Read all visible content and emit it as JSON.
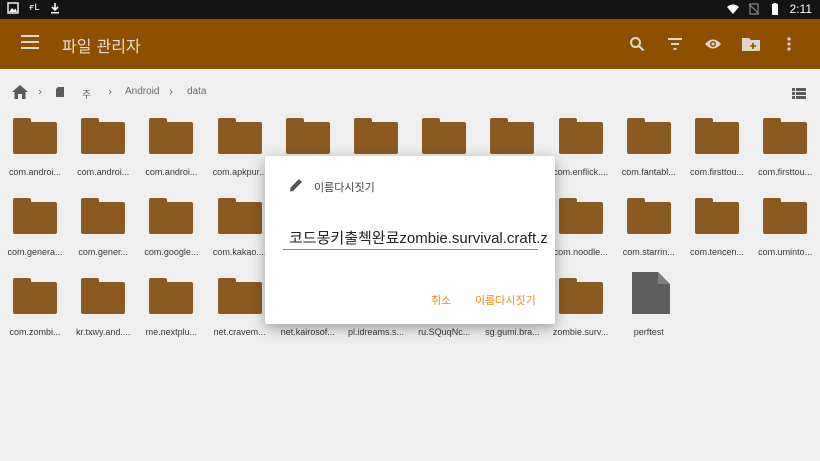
{
  "status_bar": {
    "left_icons": [
      "image-icon",
      "fl-icon",
      "download-icon"
    ],
    "fl_text": "ғL",
    "time": "2:11"
  },
  "app_bar": {
    "title": "파일 관리자",
    "color": "#ff9800",
    "actions": [
      "search-icon",
      "filter-icon",
      "eye-icon",
      "new-folder-icon",
      "more-vert-icon"
    ]
  },
  "breadcrumb": {
    "items": [
      "주",
      "Android",
      "data"
    ]
  },
  "files": [
    {
      "label": "com.androi...",
      "type": "folder"
    },
    {
      "label": "com.androi...",
      "type": "folder"
    },
    {
      "label": "com.androi...",
      "type": "folder"
    },
    {
      "label": "com.apkpur...",
      "type": "folder"
    },
    {
      "label": "",
      "type": "folder"
    },
    {
      "label": "",
      "type": "folder"
    },
    {
      "label": "",
      "type": "folder"
    },
    {
      "label": "",
      "type": "folder"
    },
    {
      "label": "com.enflick....",
      "type": "folder"
    },
    {
      "label": "com.fantabl...",
      "type": "folder"
    },
    {
      "label": "com.firsttou...",
      "type": "folder"
    },
    {
      "label": "com.firsttou...",
      "type": "folder"
    },
    {
      "label": "com.genera...",
      "type": "folder"
    },
    {
      "label": "com.gener...",
      "type": "folder"
    },
    {
      "label": "com.google...",
      "type": "folder"
    },
    {
      "label": "com.kakao....",
      "type": "folder"
    },
    {
      "label": "",
      "type": "folder"
    },
    {
      "label": "",
      "type": "folder"
    },
    {
      "label": "",
      "type": "folder"
    },
    {
      "label": "",
      "type": "folder"
    },
    {
      "label": "com.noodle...",
      "type": "folder"
    },
    {
      "label": "com.starrin...",
      "type": "folder"
    },
    {
      "label": "com.tencen...",
      "type": "folder"
    },
    {
      "label": "com.uminto...",
      "type": "folder"
    },
    {
      "label": "com.zombi...",
      "type": "folder"
    },
    {
      "label": "kr.txwy.and....",
      "type": "folder"
    },
    {
      "label": "me.nextplu...",
      "type": "folder"
    },
    {
      "label": "net.cravem...",
      "type": "folder"
    },
    {
      "label": "net.kairosof...",
      "type": "folder"
    },
    {
      "label": "pl.idreams.s...",
      "type": "folder"
    },
    {
      "label": "ru.SQuqNc...",
      "type": "folder"
    },
    {
      "label": "sg.gumi.bra...",
      "type": "folder"
    },
    {
      "label": "zombie.surv...",
      "type": "folder"
    },
    {
      "label": "perftest",
      "type": "file"
    }
  ],
  "dialog": {
    "title": "이름다시짓기",
    "input_value": "코드몽키출첵완료zombie.survival.craft.z",
    "cancel_label": "취소",
    "ok_label": "이름다시짓기",
    "accent": "#f08a18"
  }
}
